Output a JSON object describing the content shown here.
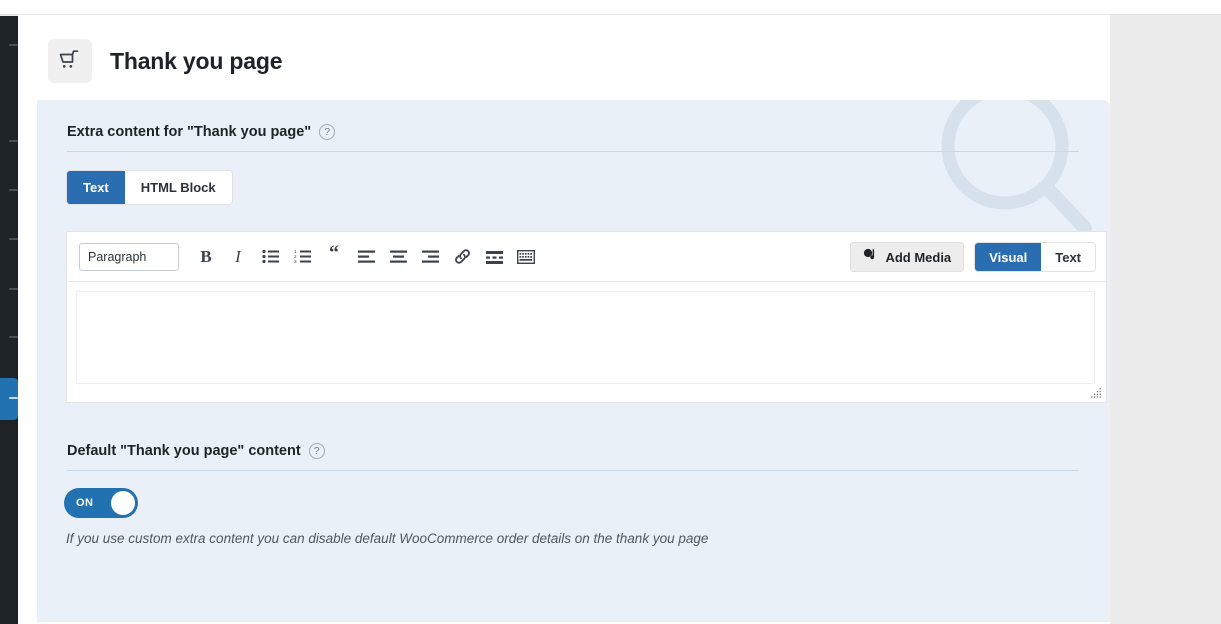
{
  "page": {
    "title": "Thank you page",
    "icon": "shopping-cart-icon"
  },
  "panel": {
    "extra_content": {
      "title": "Extra content for \"Thank you page\"",
      "help": "?"
    },
    "content_type_switch": {
      "options": [
        "Text",
        "HTML Block"
      ],
      "selected": "Text"
    },
    "editor": {
      "format_select": {
        "value": "Paragraph",
        "caret": "▼"
      },
      "toolbar_buttons": [
        {
          "name": "bold-icon",
          "glyph": "B"
        },
        {
          "name": "italic-icon",
          "glyph": "I"
        },
        {
          "name": "bulleted-list-icon",
          "glyph": ""
        },
        {
          "name": "numbered-list-icon",
          "glyph": ""
        },
        {
          "name": "blockquote-icon",
          "glyph": "“"
        },
        {
          "name": "align-left-icon",
          "glyph": ""
        },
        {
          "name": "align-center-icon",
          "glyph": ""
        },
        {
          "name": "align-right-icon",
          "glyph": ""
        },
        {
          "name": "link-icon",
          "glyph": ""
        },
        {
          "name": "read-more-icon",
          "glyph": ""
        },
        {
          "name": "toolbar-toggle-icon",
          "glyph": ""
        }
      ],
      "add_media_label": "Add Media",
      "mode_switch": {
        "options": [
          "Visual",
          "Text"
        ],
        "selected": "Visual"
      },
      "body_value": "",
      "body_placeholder": ""
    },
    "default_content": {
      "title": "Default \"Thank you page\" content",
      "help": "?",
      "toggle_state": "ON",
      "helper_text": "If you use custom extra content you can disable default WooCommerce order details on the thank you page"
    }
  },
  "colors": {
    "accent_blue": "#2271b1",
    "switch_blue": "#2a6db0",
    "panel_bg": "#eaf0f7",
    "sidebar_dark": "#1d2327",
    "page_bg": "#ececec"
  }
}
